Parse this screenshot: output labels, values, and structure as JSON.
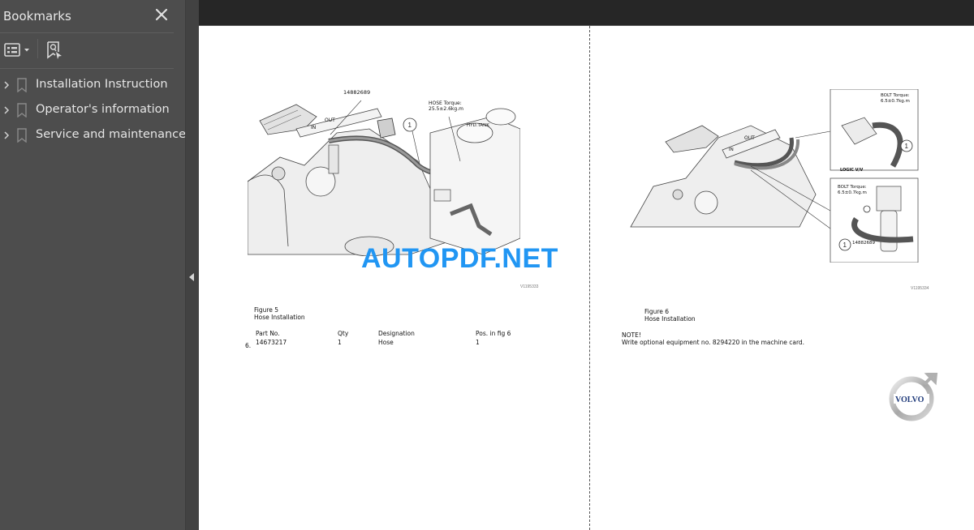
{
  "sidebar": {
    "title": "Bookmarks",
    "close_icon": "close-icon",
    "toolbar": {
      "options_icon": "list-options-icon",
      "find_icon": "find-bookmark-icon"
    },
    "items": [
      {
        "label": "Installation Instruction",
        "expanded": false
      },
      {
        "label": "Operator's information",
        "expanded": false
      },
      {
        "label": "Service and maintenance",
        "expanded": false
      }
    ]
  },
  "document": {
    "watermark": "AUTOPDF.NET",
    "left_page": {
      "figure_callouts": {
        "part": "14882689",
        "position": "1",
        "hose_torque_line1": "HOSE Torque:",
        "hose_torque_line2": "25.5±2.6kg.m",
        "tank": "HYD.TANK",
        "out": "OUT",
        "in": "IN"
      },
      "figure_ref": "V1195333",
      "figure_title": "Figure 5",
      "figure_caption": "Hose Installation",
      "step_number": "6.",
      "table": {
        "headers": [
          "Part No.",
          "Qty",
          "Designation",
          "Pos. in fig 6"
        ],
        "rows": [
          [
            "14673217",
            "1",
            "Hose",
            "1"
          ]
        ]
      }
    },
    "right_page": {
      "figure_callouts": {
        "bolt_torque_top_line1": "BOLT Torque:",
        "bolt_torque_top_line2": "6.5±0.7kg.m",
        "bolt_torque_bottom_line1": "BOLT Torque:",
        "bolt_torque_bottom_line2": "6.5±0.7kg.m",
        "logic_valve": "LOGIC V/V",
        "position": "1",
        "part": "14882689",
        "out": "OUT",
        "in": "IN"
      },
      "figure_ref": "V1195334",
      "figure_title": "Figure 6",
      "figure_caption": "Hose Installation",
      "note_title": "NOTE!",
      "note_text": "Write optional equipment no. 8294220 in the machine card.",
      "logo_text": "VOLVO"
    }
  }
}
